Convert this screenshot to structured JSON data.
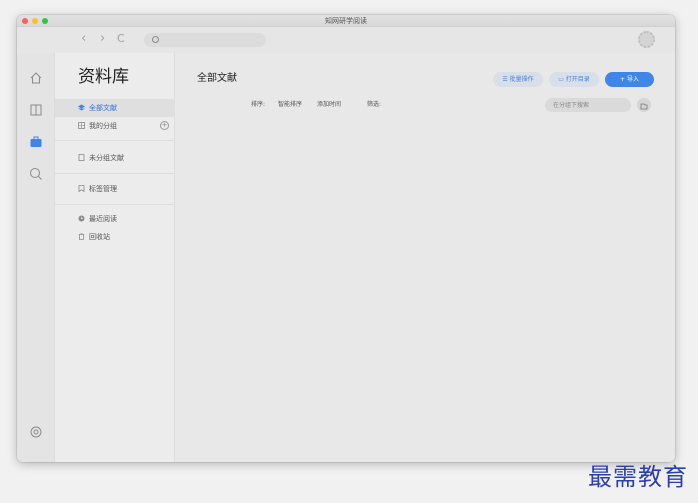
{
  "window": {
    "title": "知网研学阅读"
  },
  "toolbar": {
    "back": "‹",
    "forward": "›",
    "reload": "C",
    "search_placeholder": ""
  },
  "rail": {
    "icons": [
      "home-icon",
      "book-icon",
      "briefcase-icon",
      "search-icon",
      "settings-icon"
    ],
    "active": "briefcase-icon"
  },
  "sidebar": {
    "title": "资料库",
    "items": [
      {
        "label": "全部文献",
        "icon": "stack-icon",
        "active": true
      },
      {
        "label": "我的分组",
        "icon": "grid-icon",
        "active": false
      },
      {
        "label": "未分组文献",
        "icon": "file-icon",
        "active": false
      },
      {
        "label": "标签管理",
        "icon": "bookmark-icon",
        "active": false
      },
      {
        "label": "最近阅读",
        "icon": "clock-icon",
        "active": false
      },
      {
        "label": "回收站",
        "icon": "trash-icon",
        "active": false
      }
    ],
    "add_group": "+"
  },
  "main": {
    "title": "全部文献",
    "buttons": {
      "batch": "批量操作",
      "open_folder": "打开目录",
      "import": "导入"
    },
    "filters": {
      "sort_label": "排序:",
      "sort_value": "智能排序",
      "order_value": "添加时间",
      "filter_label": "筛选:"
    },
    "search_placeholder": "在分组下搜索"
  },
  "brand": {
    "text": "最需教育"
  },
  "colors": {
    "accent": "#3f86e6",
    "brand": "#2b3fb3"
  }
}
